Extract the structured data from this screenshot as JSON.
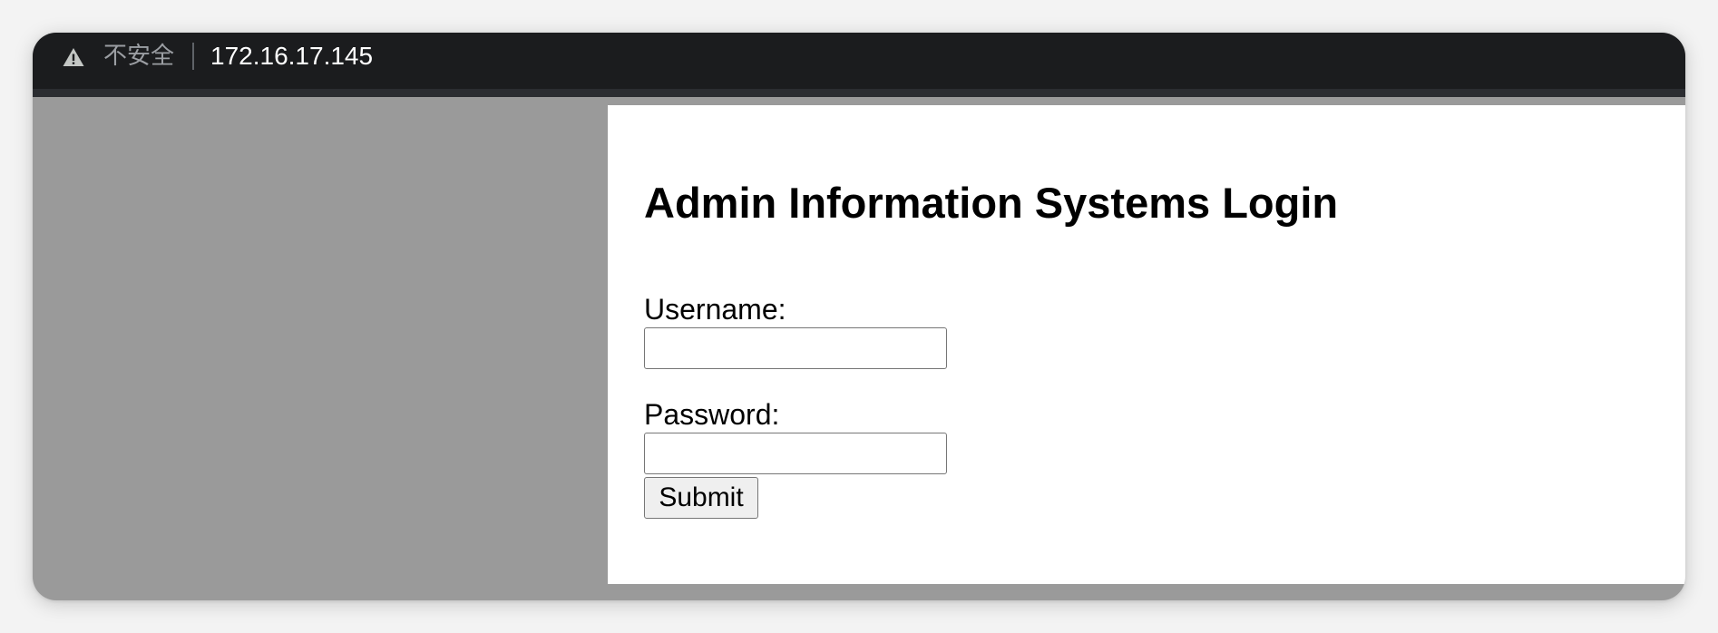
{
  "address_bar": {
    "security_label": "不安全",
    "url": "172.16.17.145",
    "icon": "warning-triangle-icon"
  },
  "page": {
    "title": "Admin Information Systems Login",
    "username_label": "Username:",
    "username_value": "",
    "password_label": "Password:",
    "password_value": "",
    "submit_label": "Submit"
  },
  "colors": {
    "address_bar_bg": "#1b1c1e",
    "page_bg": "#9a9a9a",
    "panel_bg": "#ffffff",
    "security_text": "#9b9ea3"
  }
}
